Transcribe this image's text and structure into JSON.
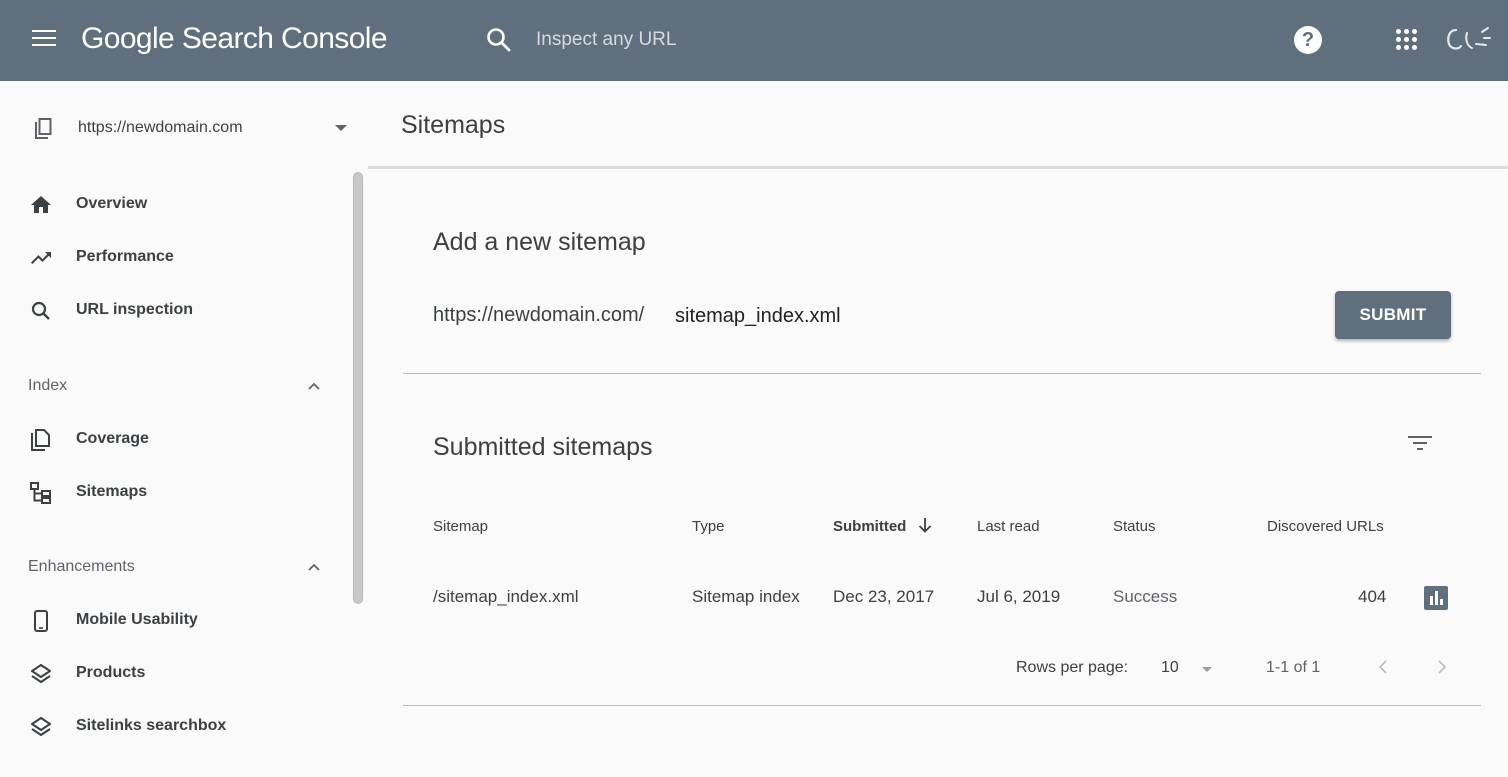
{
  "header": {
    "app_title": "Google Search Console",
    "search_placeholder": "Inspect any URL",
    "help_symbol": "?",
    "icons": [
      "menu-icon",
      "search-icon",
      "help-icon",
      "apps-icon",
      "avatar"
    ]
  },
  "sidebar": {
    "property": "https://newdomain.com",
    "items": [
      {
        "label": "Overview",
        "icon": "home-icon"
      },
      {
        "label": "Performance",
        "icon": "trending-up-icon"
      },
      {
        "label": "URL inspection",
        "icon": "search-icon"
      }
    ],
    "sections": [
      {
        "label": "Index",
        "items": [
          {
            "label": "Coverage",
            "icon": "coverage-icon"
          },
          {
            "label": "Sitemaps",
            "icon": "sitemap-icon"
          }
        ]
      },
      {
        "label": "Enhancements",
        "items": [
          {
            "label": "Mobile Usability",
            "icon": "phone-icon"
          },
          {
            "label": "Products",
            "icon": "layers-icon"
          },
          {
            "label": "Sitelinks searchbox",
            "icon": "layers-icon"
          }
        ]
      }
    ]
  },
  "main": {
    "page_title": "Sitemaps",
    "add_card": {
      "title": "Add a new sitemap",
      "url_prefix": "https://newdomain.com/",
      "input_value": "sitemap_index.xml",
      "submit_label": "SUBMIT"
    },
    "submitted": {
      "title": "Submitted sitemaps",
      "columns": [
        "Sitemap",
        "Type",
        "Submitted",
        "Last read",
        "Status",
        "Discovered URLs"
      ],
      "sorted_column": "Submitted",
      "rows": [
        {
          "sitemap": "/sitemap_index.xml",
          "type": "Sitemap index",
          "submitted": "Dec 23, 2017",
          "last_read": "Jul 6, 2019",
          "status": "Success",
          "discovered_urls": "404"
        }
      ],
      "pagination": {
        "rows_per_page_label": "Rows per page:",
        "rows_per_page": "10",
        "range": "1-1 of 1"
      }
    }
  },
  "colors": {
    "header_bg": "#5f6f7d",
    "primary_button": "#5f6f7d",
    "page_bg": "#fafafa"
  }
}
